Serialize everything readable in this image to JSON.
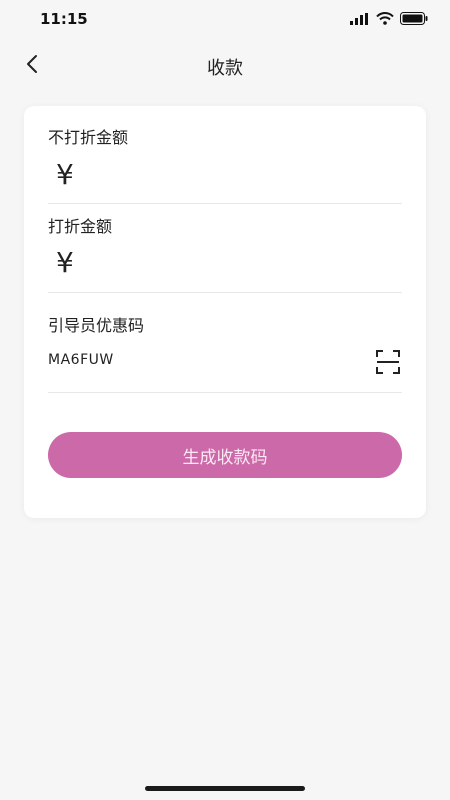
{
  "status_bar": {
    "time": "11:15",
    "icons": [
      "signal-icon",
      "wifi-icon",
      "battery-icon"
    ]
  },
  "nav": {
    "title": "收款",
    "back_icon": "chevron-left-icon"
  },
  "form": {
    "non_discount_label": "不打折金额",
    "non_discount_currency": "¥",
    "discount_label": "打折金额",
    "discount_currency": "¥",
    "guide_code_label": "引导员优惠码",
    "guide_code_value": "MA6FUW",
    "scan_icon": "scan-icon"
  },
  "actions": {
    "generate_label": "生成收款码"
  },
  "colors": {
    "accent": "#cc69a9",
    "background": "#f6f6f7",
    "card": "#ffffff"
  }
}
